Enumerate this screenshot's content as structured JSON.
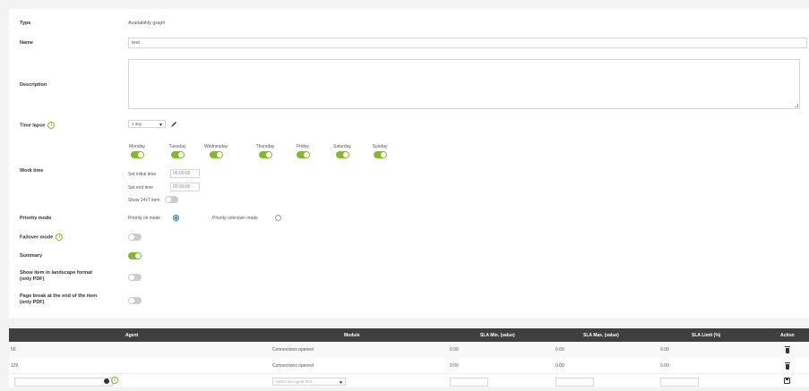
{
  "form": {
    "type_label": "Type",
    "type_value": "Availability graph",
    "name_label": "Name",
    "name_value": "test",
    "description_label": "Description",
    "time_lapse_label": "Time lapse",
    "time_lapse_value": "1 day",
    "work_time_label": "Work time",
    "days": [
      {
        "label": "Monday",
        "on": true
      },
      {
        "label": "Tuesday",
        "on": true
      },
      {
        "label": "Wednesday",
        "on": true
      },
      {
        "label": "Thursday",
        "on": true
      },
      {
        "label": "Friday",
        "on": true
      },
      {
        "label": "Saturday",
        "on": true
      },
      {
        "label": "Sunday",
        "on": true
      }
    ],
    "set_initial_time_label": "Set initial time",
    "set_initial_time_value": "00:00:00",
    "set_end_time_label": "Set end time",
    "set_end_time_value": "00:00:00",
    "show_24x7_label": "Show 24x7 item",
    "priority_mode_label": "Priority mode",
    "priority_ok_label": "Priority ok mode",
    "priority_unknown_label": "Priority unknown mode",
    "failover_mode_label": "Failover mode",
    "summary_label": "Summary",
    "landscape_label_1": "Show item in landscape format",
    "landscape_label_2": "(only PDF)",
    "page_break_label_1": "Page break at the end of the item",
    "page_break_label_2": "(only PDF)"
  },
  "table": {
    "headers": {
      "agent": "Agent",
      "module": "Module",
      "sla_min": "SLA Min. (value)",
      "sla_max": "SLA Max. (value)",
      "sla_limit": "SLA Limit (%)",
      "action": "Action"
    },
    "rows": [
      {
        "agent": "50",
        "module": "Connections opened",
        "sla_min": "0.00",
        "sla_max": "0.00",
        "sla_limit": "0.00"
      },
      {
        "agent": "129",
        "module": "Connections opened",
        "sla_min": "0.00",
        "sla_max": "0.00",
        "sla_limit": "0.00"
      }
    ],
    "new_row": {
      "module_placeholder": "Select an Agent first"
    }
  },
  "colors": {
    "accent_green": "#82b92e",
    "header_dark": "#3f3f3f",
    "radio_blue": "#1b70b8"
  }
}
